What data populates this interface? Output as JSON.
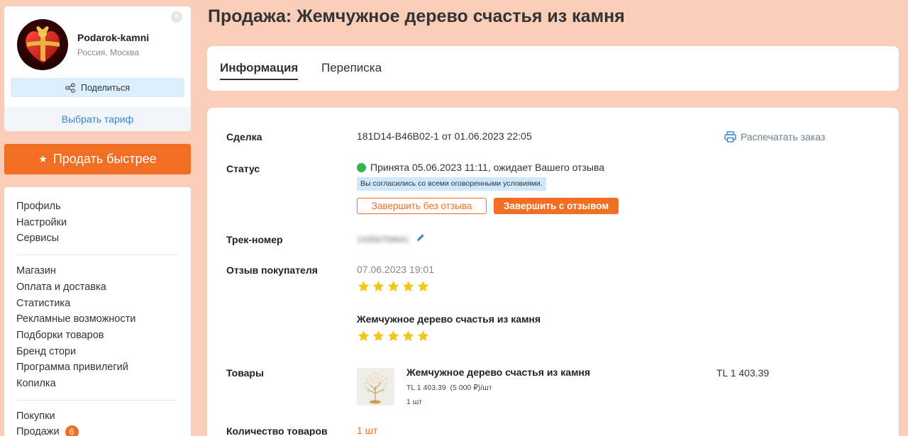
{
  "shop": {
    "name": "Podarok-kamni",
    "location": "Россия, Москва",
    "share_label": "Поделиться",
    "tariff_label": "Выбрать тариф"
  },
  "sell_fast_label": "Продать быстрее",
  "menu": {
    "group1": [
      "Профиль",
      "Настройки",
      "Сервисы"
    ],
    "group2": [
      "Магазин",
      "Оплата и доставка",
      "Статистика",
      "Рекламные возможности",
      "Подборки товаров",
      "Бренд стори",
      "Программа привилегий",
      "Копилка"
    ],
    "group3": [
      {
        "label": "Покупки"
      },
      {
        "label": "Продажи",
        "badge": "6"
      }
    ]
  },
  "page_title": "Продажа: Жемчужное дерево счастья из камня",
  "tabs": [
    {
      "label": "Информация",
      "active": true
    },
    {
      "label": "Переписка",
      "active": false
    }
  ],
  "order": {
    "deal_label": "Сделка",
    "deal_value": "181D14-B46B02-1 от 01.06.2023 22:05",
    "print_label": "Распечатать заказ",
    "status_label": "Статус",
    "status_value": "Принята 05.06.2023 11:11, ожидает Вашего отзыва",
    "status_color": "#2fb553",
    "agree_note": "Вы согласились со всеми оговоренными условиями.",
    "finish_no_review": "Завершить без отзыва",
    "finish_with_review": "Завершить с отзывом",
    "track_label": "Трек-номер",
    "track_value": "14356759641",
    "review_label": "Отзыв покупателя",
    "review_date": "07.06.2023 19:01",
    "review_rating": 5,
    "review_product_title": "Жемчужное дерево счастья из камня",
    "review_product_rating": 5,
    "goods_label": "Товары",
    "product_name": "Жемчужное дерево счастья из камня",
    "product_price": "TL 1 403.39",
    "product_price_rub": "(5 000 ₽)/шт",
    "product_qty": "1 шт",
    "product_total": "TL 1 403.39",
    "qty_label": "Количество товаров",
    "qty_value": "1 шт"
  },
  "colors": {
    "accent": "#f26e22",
    "background": "#f9cdb8",
    "link": "#3a85c7",
    "star": "#f5c518"
  }
}
